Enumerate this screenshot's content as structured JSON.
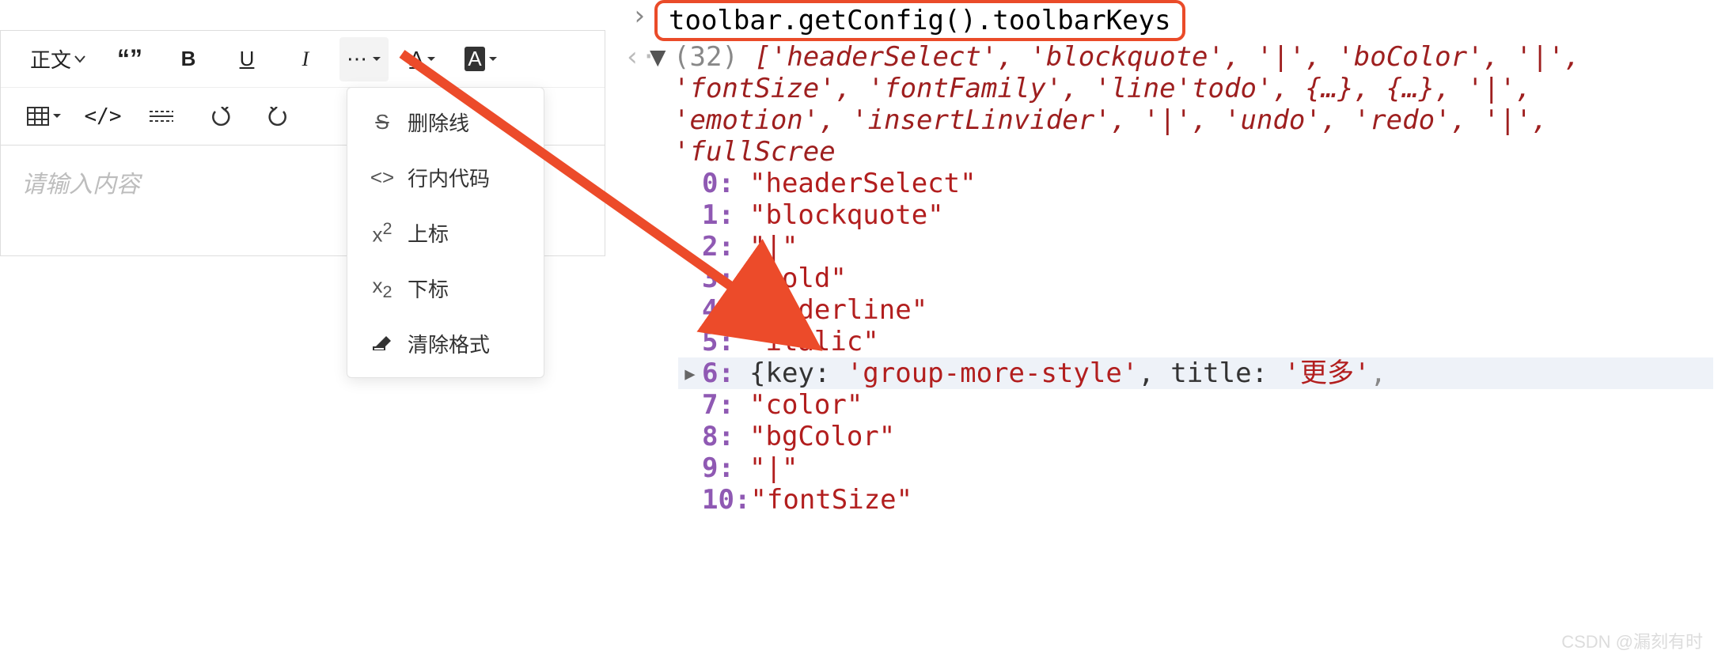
{
  "editor": {
    "placeholder": "请输入内容",
    "toolbar": {
      "heading_label": "正文",
      "dropdown": {
        "strike": "删除线",
        "code_inline": "行内代码",
        "sup": "上标",
        "sub": "下标",
        "clear": "清除格式"
      }
    }
  },
  "console": {
    "input": "toolbar.getConfig().toolbarKeys",
    "summary_count": "(32)",
    "summary_tail": "['headerSelect', 'blockquote', '|', 'boColor', '|', 'fontSize', 'fontFamily', 'line'todo', {…}, {…}, '|', 'emotion', 'insertLinvider', '|', 'undo', 'redo', '|', 'fullScree",
    "entries": [
      {
        "idx": "0:",
        "val": "\"headerSelect\""
      },
      {
        "idx": "1:",
        "val": "\"blockquote\""
      },
      {
        "idx": "2:",
        "val": "\"|\""
      },
      {
        "idx": "3:",
        "val": "\"bold\""
      },
      {
        "idx": "4:",
        "val": "\"underline\""
      },
      {
        "idx": "5:",
        "val": "\"italic\""
      },
      {
        "idx": "6:",
        "obj_pre": "{key: ",
        "obj_val": "'group-more-style'",
        "obj_mid": ", title: ",
        "obj_val2": "'更多'",
        "selected": true
      },
      {
        "idx": "7:",
        "val": "\"color\""
      },
      {
        "idx": "8:",
        "val": "\"bgColor\""
      },
      {
        "idx": "9:",
        "val": "\"|\""
      },
      {
        "idx": "10:",
        "val": "\"fontSize\""
      }
    ]
  },
  "watermark": "CSDN @漏刻有时"
}
